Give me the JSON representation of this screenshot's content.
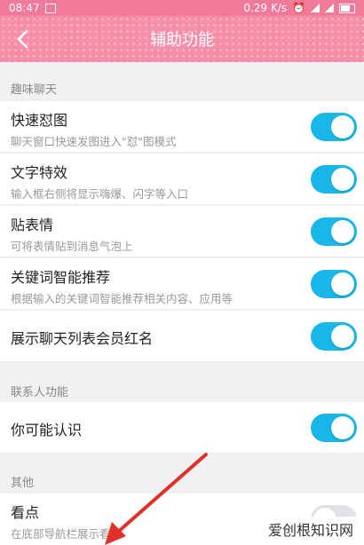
{
  "status_bar": {
    "time": "08:47",
    "speed": "0.29 K/s"
  },
  "header": {
    "title": "辅助功能"
  },
  "sections": {
    "fun_chat": "趣味聊天",
    "contacts": "联系人功能",
    "other": "其他"
  },
  "rows": [
    {
      "title": "快速怼图",
      "subtitle": "聊天窗口快速发图进入\"怼\"图模式",
      "on": true
    },
    {
      "title": "文字特效",
      "subtitle": "输入框右侧将显示嗨爆、闪字等入口",
      "on": true
    },
    {
      "title": "贴表情",
      "subtitle": "可将表情贴到消息气泡上",
      "on": true
    },
    {
      "title": "关键词智能推荐",
      "subtitle": "根据输入的关键词智能推荐相关内容、应用等",
      "on": true
    },
    {
      "title": "展示聊天列表会员红名",
      "subtitle": "",
      "on": true
    },
    {
      "title": "你可能认识",
      "subtitle": "",
      "on": true
    },
    {
      "title": "看点",
      "subtitle": "在底部导航栏展示看点",
      "on": false
    }
  ],
  "watermark": "爱创根知识网",
  "colors": {
    "header": "#f58ea8",
    "toggle_on": "#18b7e8",
    "arrow": "#e0302c"
  }
}
